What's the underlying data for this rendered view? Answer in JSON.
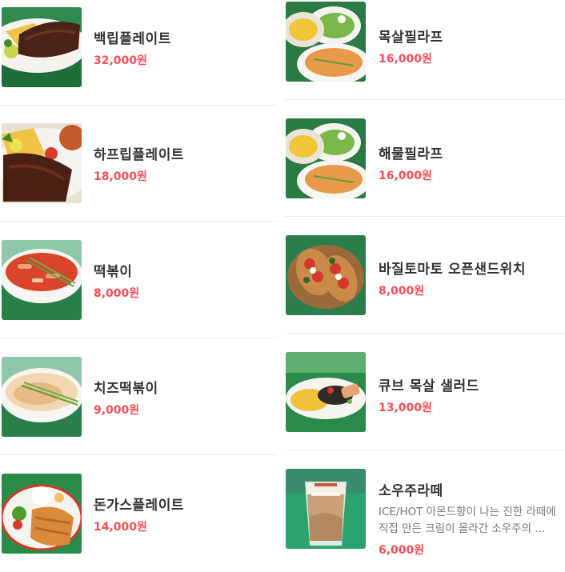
{
  "colors": {
    "price": "#ff4b55",
    "name": "#333333",
    "divider": "#ececec"
  },
  "menu_left": [
    {
      "name": "백립플레이트",
      "price": "32,000원",
      "image": "ribs-plate"
    },
    {
      "name": "하프립플레이트",
      "price": "18,000원",
      "image": "half-ribs-plate"
    },
    {
      "name": "떡볶이",
      "price": "8,000원",
      "image": "tteokbokki"
    },
    {
      "name": "치즈떡볶이",
      "price": "9,000원",
      "image": "cheese-tteokbokki"
    },
    {
      "name": "돈가스플레이트",
      "price": "14,000원",
      "image": "pork-cutlet-plate"
    }
  ],
  "menu_right": [
    {
      "name": "목살필라프",
      "price": "16,000원",
      "image": "pork-neck-pilaf"
    },
    {
      "name": "해물필라프",
      "price": "16,000원",
      "image": "seafood-pilaf"
    },
    {
      "name": "바질토마토 오픈샌드위치",
      "price": "8,000원",
      "image": "basil-tomato-sandwich"
    },
    {
      "name": "큐브 목살 샐러드",
      "price": "13,000원",
      "image": "cube-pork-salad"
    },
    {
      "name": "소우주라떼",
      "desc_line1": "ICE/HOT 아몬드향이 나는 진한 라떼에",
      "desc_line2": "직접 만든 크림이 올라간 소우주의 ...",
      "price": "6,000원",
      "image": "latte"
    }
  ]
}
